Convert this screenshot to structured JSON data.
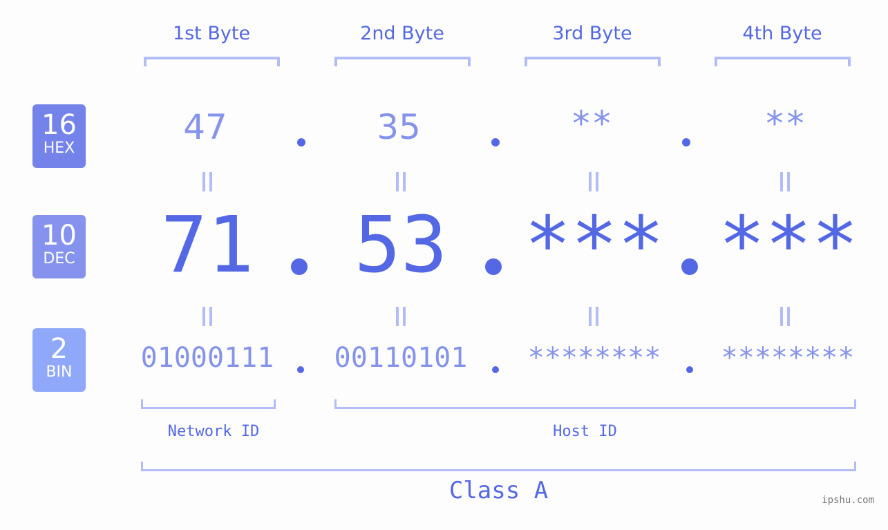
{
  "bytes": {
    "headers": [
      "1st Byte",
      "2nd Byte",
      "3rd Byte",
      "4th Byte"
    ]
  },
  "badges": {
    "hex": {
      "num": "16",
      "label": "HEX",
      "color": "#7383ea"
    },
    "dec": {
      "num": "10",
      "label": "DEC",
      "color": "#8593ef"
    },
    "bin": {
      "num": "2",
      "label": "BIN",
      "color": "#8fa8f9"
    }
  },
  "hex": [
    "47",
    "35",
    "**",
    "**"
  ],
  "dec": [
    "71",
    "53",
    "***",
    "***"
  ],
  "bin": [
    "01000111",
    "00110101",
    "********",
    "********"
  ],
  "separator": ".",
  "labels": {
    "network_id": "Network ID",
    "host_id": "Host ID",
    "class": "Class A"
  },
  "watermark": "ipshu.com",
  "colors": {
    "primary": "#5468e6",
    "secondary": "#8593ec",
    "bracket": "#b2bcf7",
    "background": "#fcfdfc"
  }
}
